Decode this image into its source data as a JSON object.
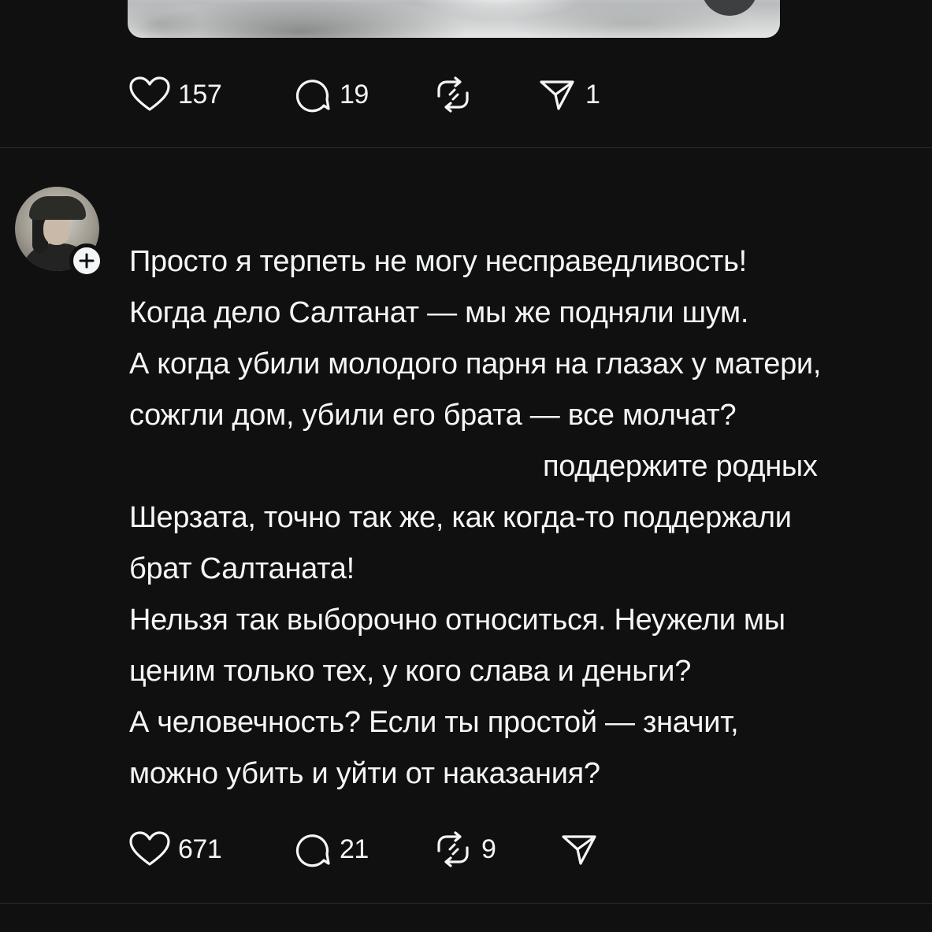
{
  "post_top": {
    "media_alt": "video preview",
    "actions": {
      "likes": "157",
      "comments": "19",
      "reposts": "",
      "shares": "1"
    }
  },
  "post_main": {
    "lines": [
      "Просто я терпеть не могу несправедливость!",
      "Когда дело Салтанат — мы же подняли шум.",
      "А когда убили молодого парня на глазах у матери,",
      "сожгли дом, убили его брата — все молчат?",
      "поддержите родных",
      "Шерзата, точно так же, как когда-то поддержали",
      "брат Салтаната!",
      "Нельзя так выборочно относиться. Неужели мы",
      "ценим только тех, у кого слава и деньги?",
      "А человечность? Если ты простой — значит,",
      "можно убить и уйти от наказания?"
    ],
    "actions": {
      "likes": "671",
      "comments": "21",
      "reposts": "9",
      "shares": ""
    }
  },
  "icons": {
    "like": "heart-icon",
    "comment": "comment-bubble-icon",
    "repost": "repost-icon",
    "share": "send-icon",
    "follow": "plus-icon"
  },
  "colors": {
    "background": "#101010",
    "text": "#f3f5f7",
    "divider": "#2a2a2a"
  }
}
